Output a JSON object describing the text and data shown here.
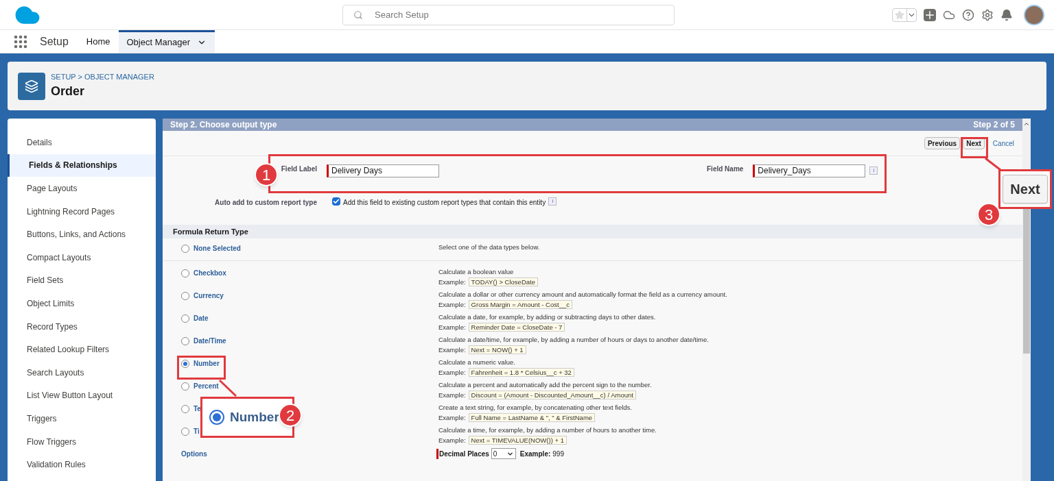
{
  "header": {
    "search": {
      "placeholder": "Search Setup"
    }
  },
  "nav": {
    "app_name": "Setup",
    "tabs": [
      {
        "label": "Home",
        "selected": false
      },
      {
        "label": "Object Manager",
        "selected": true
      }
    ]
  },
  "object_header": {
    "breadcrumb": "SETUP > OBJECT MANAGER",
    "title": "Order"
  },
  "sidebar": {
    "items": [
      {
        "label": "Details",
        "selected": false
      },
      {
        "label": "Fields & Relationships",
        "selected": true
      },
      {
        "label": "Page Layouts",
        "selected": false
      },
      {
        "label": "Lightning Record Pages",
        "selected": false
      },
      {
        "label": "Buttons, Links, and Actions",
        "selected": false
      },
      {
        "label": "Compact Layouts",
        "selected": false
      },
      {
        "label": "Field Sets",
        "selected": false
      },
      {
        "label": "Object Limits",
        "selected": false
      },
      {
        "label": "Record Types",
        "selected": false
      },
      {
        "label": "Related Lookup Filters",
        "selected": false
      },
      {
        "label": "Search Layouts",
        "selected": false
      },
      {
        "label": "List View Button Layout",
        "selected": false
      },
      {
        "label": "Triggers",
        "selected": false
      },
      {
        "label": "Flow Triggers",
        "selected": false
      },
      {
        "label": "Validation Rules",
        "selected": false
      }
    ]
  },
  "wizard": {
    "step_title": "Step 2. Choose output type",
    "step_count": "Step 2 of 5",
    "buttons": {
      "previous": "Previous",
      "next": "Next",
      "cancel": "Cancel"
    },
    "field_label": {
      "label": "Field Label",
      "value": "Delivery Days"
    },
    "field_name": {
      "label": "Field Name",
      "value": "Delivery_Days",
      "info": "i"
    },
    "auto_add": {
      "label": "Auto add to custom report type",
      "text": "Add this field to existing custom report types that contain this entity",
      "checked": true,
      "info": "i"
    },
    "return_type_title": "Formula Return Type",
    "types": [
      {
        "label": "None Selected",
        "selected": false,
        "description": "Select one of the data types below."
      },
      {
        "label": "Checkbox",
        "selected": false,
        "description": "Calculate a boolean value",
        "example_label": "Example:",
        "example": "TODAY() > CloseDate"
      },
      {
        "label": "Currency",
        "selected": false,
        "description": "Calculate a dollar or other currency amount and automatically format the field as a currency amount.",
        "example_label": "Example:",
        "example": "Gross Margin = Amount - Cost__c"
      },
      {
        "label": "Date",
        "selected": false,
        "description": "Calculate a date, for example, by adding or subtracting days to other dates.",
        "example_label": "Example:",
        "example": "Reminder Date = CloseDate - 7"
      },
      {
        "label": "Date/Time",
        "selected": false,
        "description": "Calculate a date/time, for example, by adding a number of hours or days to another date/time.",
        "example_label": "Example:",
        "example": "Next = NOW() + 1"
      },
      {
        "label": "Number",
        "selected": true,
        "description": "Calculate a numeric value.",
        "example_label": "Example:",
        "example": "Fahrenheit = 1.8 * Celsius__c + 32"
      },
      {
        "label": "Percent",
        "selected": false,
        "description": "Calculate a percent and automatically add the percent sign to the number.",
        "example_label": "Example:",
        "example": "Discount = (Amount - Discounted_Amount__c) / Amount"
      },
      {
        "label": "Te",
        "selected": false,
        "description": "Create a text string, for example, by concatenating other text fields.",
        "example_label": "Example:",
        "example": "Full Name = LastName & \", \" & FirstName"
      },
      {
        "label": "Ti",
        "selected": false,
        "description": "Calculate a time, for example, by adding a number of hours to another time.",
        "example_label": "Example:",
        "example": "Next = TIMEVALUE(NOW()) + 1"
      }
    ],
    "options": {
      "label": "Options",
      "decimal_label": "Decimal Places",
      "decimal_value": "0",
      "example_label": "Example:",
      "example_value": "999"
    }
  },
  "callouts": [
    {
      "number": "1"
    },
    {
      "number": "2",
      "text": "Number"
    },
    {
      "number": "3",
      "text": "Next"
    }
  ]
}
